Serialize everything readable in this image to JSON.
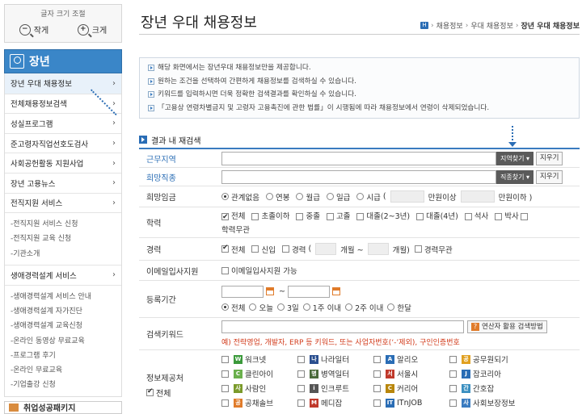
{
  "sidebar": {
    "fontsize": {
      "title": "글자 크기 조절",
      "smaller": "작게",
      "larger": "크게"
    },
    "menu_title": "장년",
    "items": [
      {
        "label": "장년 우대 채용정보",
        "active": true
      },
      {
        "label": "전체채용정보검색"
      },
      {
        "label": "성실프로그램"
      },
      {
        "label": "준고령자직업선호도검사"
      },
      {
        "label": "사회공헌활동 지원사업"
      },
      {
        "label": "장년 고용뉴스"
      },
      {
        "label": "전직지원 서비스"
      }
    ],
    "sub1": [
      "-전직지원 서비스 신청",
      "-전직지원 교육 신청",
      "-기관소개"
    ],
    "item8": "생애경력설계 서비스",
    "sub2": [
      "-생애경력설계 서비스 안내",
      "-생애경력설계 자가진단",
      "-생애경력설계 교육신청",
      "-온라인 동영상 무료교육",
      "-프로그램 후기",
      "-온라인 무료교육",
      "-기업출강 신청"
    ],
    "bottom": "취업성공패키지"
  },
  "main": {
    "title": "장년 우대 채용정보",
    "breadcrumb": {
      "home": "H",
      "items": [
        "채용정보",
        "우대 채용정보",
        "장년 우대 채용정보"
      ]
    },
    "notices": [
      "해당 화면에서는 장년우대 채용정보만을 제공합니다.",
      "원하는 조건을 선택하여 간편하게 채용정보를 검색하실 수 있습니다.",
      "키워드를 입력하시면 더욱 정확한 검색결과를 확인하실 수 있습니다.",
      "「고용상 연령차별금지 및 고령자 고용촉진에 관한 법률」이 시행됨에 따라 채용정보에서 연령이 삭제되었습니다."
    ],
    "section": "결과 내 재검색",
    "rows": {
      "region": {
        "label": "근무지역",
        "btn": "지역찾기",
        "clear": "지우기"
      },
      "job": {
        "label": "희망직종",
        "btn": "직종찾기",
        "clear": "지우기"
      },
      "wage": {
        "label": "희망임금",
        "opts": [
          "관계없음",
          "연봉",
          "월급",
          "일급",
          "시급"
        ],
        "paren_open": "(",
        "min": "만원이상",
        "max": "만원이하 )"
      },
      "edu": {
        "label": "학력",
        "opts": [
          "전체",
          "초졸이하",
          "중졸",
          "고졸",
          "대졸(2~3년)",
          "대졸(4년)",
          "석사",
          "박사",
          "학력무관"
        ]
      },
      "career": {
        "label": "경력",
        "all": "전체",
        "new": "신입",
        "exp": "경력",
        "paren_open": "(",
        "from": "개월 ~",
        "to": "개월)",
        "none": "경력무관"
      },
      "email": {
        "label": "이메일입사지원",
        "opt": "이메일입사지원 가능"
      },
      "period": {
        "label": "등록기간",
        "tilde": "~",
        "opts": [
          "전체",
          "오늘",
          "3일",
          "1주 이내",
          "2주 이내",
          "한달"
        ]
      },
      "keyword": {
        "label": "검색키워드",
        "helper_icon": "?",
        "helper": "연산자 활용 검색방법",
        "example": "예) 전략영업, 개발자, ERP 등 키워드, 또는 사업자번호(‘-’제외), 구인인증번호"
      },
      "source": {
        "label": "정보제공처",
        "all": "전체",
        "items": [
          {
            "name": "워크넷",
            "color": "#3b9a3b",
            "glyph": "W"
          },
          {
            "name": "나라일터",
            "color": "#2a4f8f",
            "glyph": "나"
          },
          {
            "name": "알리오",
            "color": "#2a6db5",
            "glyph": "A"
          },
          {
            "name": "공무원되기",
            "color": "#e0a020",
            "glyph": "공"
          },
          {
            "name": "클린아이",
            "color": "#6ab04c",
            "glyph": "C"
          },
          {
            "name": "병역일터",
            "color": "#4a6a3a",
            "glyph": "병"
          },
          {
            "name": "서울시",
            "color": "#c0392b",
            "glyph": "서"
          },
          {
            "name": "잡코리아",
            "color": "#2a6db5",
            "glyph": "J"
          },
          {
            "name": "사람인",
            "color": "#7a9a2a",
            "glyph": "사"
          },
          {
            "name": "인크루트",
            "color": "#555555",
            "glyph": "i"
          },
          {
            "name": "커리어",
            "color": "#b8860b",
            "glyph": "C"
          },
          {
            "name": "간호잡",
            "color": "#3a8fc0",
            "glyph": "간"
          },
          {
            "name": "공채솔브",
            "color": "#e07b2a",
            "glyph": "공"
          },
          {
            "name": "메디잡",
            "color": "#c0392b",
            "glyph": "M"
          },
          {
            "name": "ITnJOB",
            "color": "#2a6db5",
            "glyph": "IT"
          },
          {
            "name": "사회보장정보",
            "color": "#3a7bc0",
            "glyph": "사"
          }
        ]
      }
    }
  }
}
